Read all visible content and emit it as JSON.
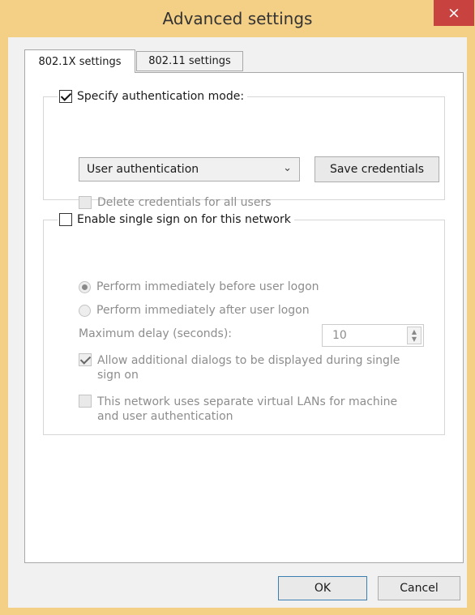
{
  "window": {
    "title": "Advanced settings",
    "close_glyph": "×"
  },
  "tabs": [
    {
      "label": "802.1X settings",
      "active": true
    },
    {
      "label": "802.11 settings",
      "active": false
    }
  ],
  "auth_group": {
    "specify_mode_label": "Specify authentication mode:",
    "specify_mode_checked": true,
    "mode_select_value": "User authentication",
    "save_credentials_label": "Save credentials",
    "delete_credentials_label": "Delete credentials for all users",
    "delete_credentials_checked": false
  },
  "sso_group": {
    "enable_label": "Enable single sign on for this network",
    "enable_checked": false,
    "radio_before_label": "Perform immediately before user logon",
    "radio_after_label": "Perform immediately after user logon",
    "selected_radio": "before",
    "max_delay_label": "Maximum delay (seconds):",
    "max_delay_value": "10",
    "allow_dialogs_line1": "Allow additional dialogs to be displayed during single",
    "allow_dialogs_line2": "sign on",
    "allow_dialogs_checked": true,
    "separate_vlans_line1": "This network uses separate virtual LANs for machine",
    "separate_vlans_line2": "and user authentication",
    "separate_vlans_checked": false
  },
  "footer": {
    "ok_label": "OK",
    "cancel_label": "Cancel"
  },
  "colors": {
    "title_bar": "#f4cf86",
    "close_button": "#c8433f",
    "disabled_text": "#8d8d8d"
  }
}
